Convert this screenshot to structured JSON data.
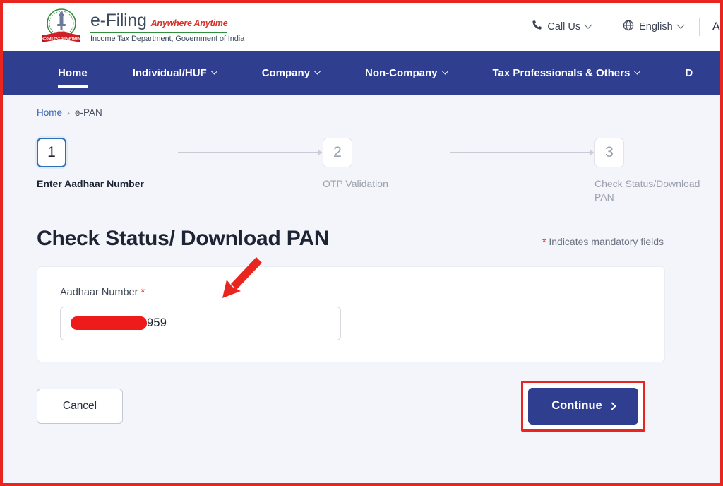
{
  "header": {
    "logo": {
      "emblem_alt": "india-emblem-income-tax-department",
      "title": "e-Filing",
      "tagline": "Anywhere Anytime",
      "department": "Income Tax Department, Government of India"
    },
    "call_us": "Call Us",
    "language": "English",
    "font_size_control": "A"
  },
  "nav": {
    "items": [
      {
        "label": "Home",
        "has_caret": false,
        "active": true
      },
      {
        "label": "Individual/HUF",
        "has_caret": true,
        "active": false
      },
      {
        "label": "Company",
        "has_caret": true,
        "active": false
      },
      {
        "label": "Non-Company",
        "has_caret": true,
        "active": false
      },
      {
        "label": "Tax Professionals & Others",
        "has_caret": true,
        "active": false
      },
      {
        "label": "D",
        "has_caret": false,
        "active": false
      }
    ]
  },
  "breadcrumb": {
    "home": "Home",
    "separator": "›",
    "current": "e-PAN"
  },
  "stepper": {
    "steps": [
      {
        "number": "1",
        "label": "Enter Aadhaar Number",
        "state": "active"
      },
      {
        "number": "2",
        "label": "OTP Validation",
        "state": "inactive"
      },
      {
        "number": "3",
        "label": "Check Status/Download PAN",
        "state": "inactive"
      }
    ]
  },
  "main": {
    "title": "Check Status/ Download PAN",
    "mandatory_star": "*",
    "mandatory_note": "Indicates mandatory fields",
    "form": {
      "aadhaar_label": "Aadhaar Number",
      "aadhaar_required_star": "*",
      "aadhaar_value_visible": "959",
      "aadhaar_redacted": true
    },
    "buttons": {
      "cancel": "Cancel",
      "continue": "Continue"
    }
  },
  "colors": {
    "nav_blue": "#2f3e8e",
    "annotation_red": "#e8251f",
    "redaction_red": "#ef1b1b",
    "page_bg": "#f4f5fa",
    "link_blue": "#3b64b4",
    "required_red": "#d8332a",
    "brand_green": "#2f8f3f"
  }
}
